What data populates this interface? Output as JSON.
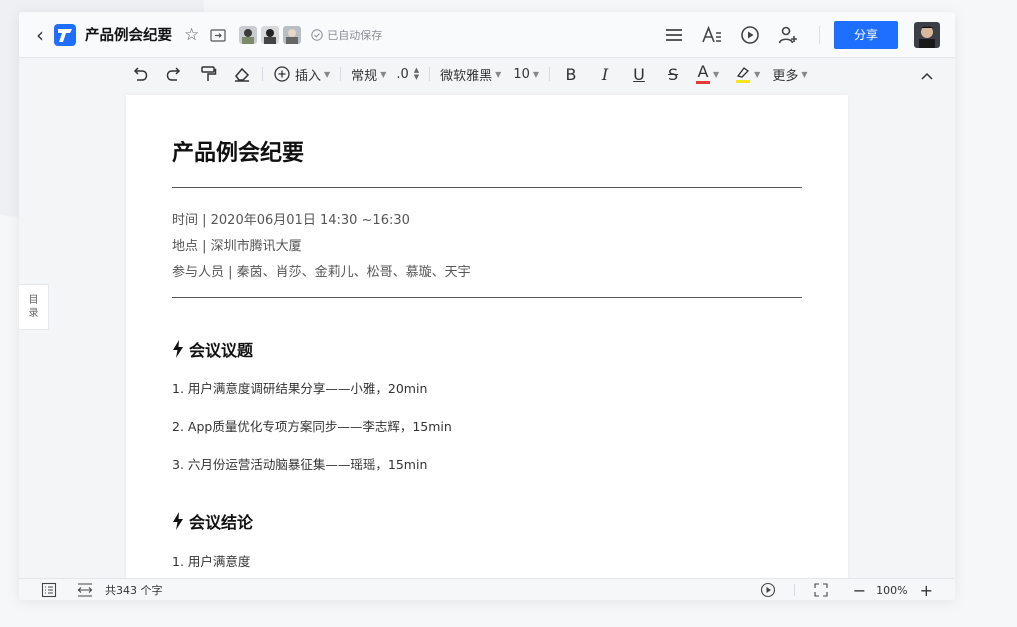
{
  "header": {
    "doc_title": "产品例会纪要",
    "save_status": "已自动保存",
    "share_label": "分享"
  },
  "toolbar": {
    "insert_label": "插入",
    "style_label": "常规",
    "spacing_label": ".0",
    "font_label": "微软雅黑",
    "size_label": "10",
    "bold_label": "B",
    "italic_label": "I",
    "underline_label": "U",
    "strike_label": "S",
    "font_color_label": "A",
    "more_label": "更多"
  },
  "sidebar": {
    "toc_label_1": "目",
    "toc_label_2": "录"
  },
  "document": {
    "title": "产品例会纪要",
    "meta": [
      "时间 | 2020年06月01日  14:30 ~16:30",
      "地点 | 深圳市腾讯大厦",
      "参与人员 | 秦茵、肖莎、金莉儿、松哥、慕璇、天宇"
    ],
    "sections": [
      {
        "heading": "会议议题",
        "items": [
          "1. 用户满意度调研结果分享——小雅，20min",
          "2. App质量优化专项方案同步——李志辉，15min",
          "3. 六月份运营活动脑暴征集——瑶瑶，15min"
        ]
      },
      {
        "heading": "会议结论",
        "items": [
          "1. 用户满意度"
        ]
      }
    ]
  },
  "status": {
    "word_count": "共343 个字",
    "zoom": "100%"
  },
  "colors": {
    "accent": "#1e6fff",
    "font_color_bar": "#e53935",
    "highlight_bar": "#f5e51a"
  }
}
